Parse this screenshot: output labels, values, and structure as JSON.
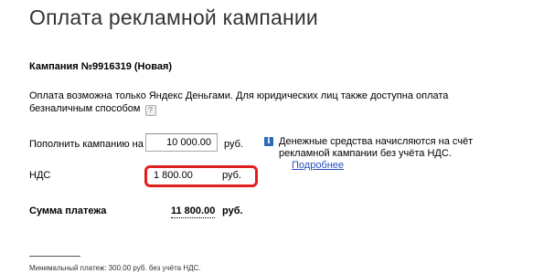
{
  "page": {
    "title": "Оплата рекламной кампании"
  },
  "campaign": {
    "title": "Кампания №9916319 (Новая)",
    "payment_note": "Оплата возможна только Яндекс Деньгами. Для юридических лиц также доступна оплата безналичным способом",
    "help_icon": "?"
  },
  "form": {
    "topup_label": "Пополнить кампанию на",
    "topup_value": "10 000.00",
    "topup_currency": "руб.",
    "vat_label": "НДС",
    "vat_value": "1 800.00",
    "vat_currency": "руб.",
    "sum_label": "Сумма платежа",
    "sum_value": "11 800.00",
    "sum_currency": "руб."
  },
  "info": {
    "icon": "info-icon",
    "icon_glyph": "i",
    "text": "Денежные средства начисляются на счёт рекламной кампании без учёта НДС.",
    "link": "Подробнее"
  },
  "footer": {
    "min_payment": "Минимальный платеж: 300.00 руб. без учёта НДС."
  },
  "colors": {
    "highlight": "#e02020",
    "link": "#2a4fbd",
    "info_icon": "#2a6db7"
  }
}
